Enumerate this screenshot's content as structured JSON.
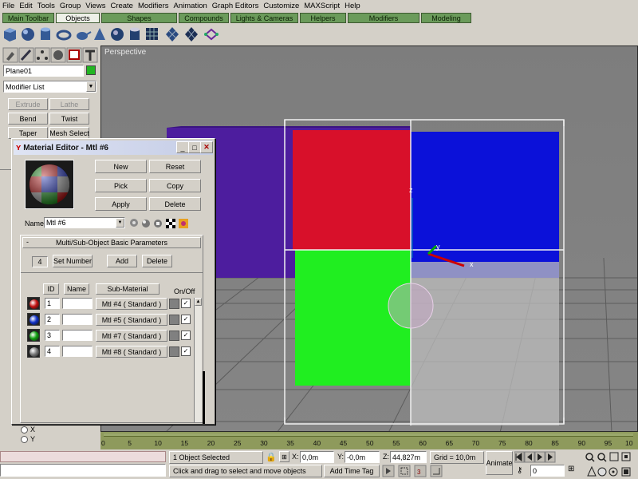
{
  "menu": [
    "File",
    "Edit",
    "Tools",
    "Group",
    "Views",
    "Create",
    "Modifiers",
    "Animation",
    "Graph Editors",
    "Customize",
    "MAXScript",
    "Help"
  ],
  "tabs": [
    "Main Toolbar",
    "Objects",
    "Shapes",
    "Compounds",
    "Lights & Cameras",
    "Helpers",
    "Modifiers",
    "Modeling"
  ],
  "toolbar_icons": [
    "box-icon",
    "sphere-icon",
    "cylinder-icon",
    "torus-icon",
    "teapot-icon",
    "cone-icon",
    "geosphere-icon",
    "tube-icon",
    "grid-icon",
    "plane-icon",
    "pyramid-icon",
    "link-icon"
  ],
  "command_panel": {
    "tab_icons": [
      "create-icon",
      "modify-icon",
      "hierarchy-icon",
      "motion-icon",
      "display-icon",
      "utilities-icon"
    ],
    "object_name": "Plane01",
    "object_color": "#22b522",
    "modifier_list": "Modifier List",
    "modifier_buttons": [
      {
        "label": "Extrude",
        "enabled": false
      },
      {
        "label": "Lathe",
        "enabled": false
      },
      {
        "label": "Bend",
        "enabled": true
      },
      {
        "label": "Twist",
        "enabled": true
      },
      {
        "label": "Taper",
        "enabled": true
      },
      {
        "label": "Mesh Select",
        "enabled": true
      }
    ],
    "axis_x": "X",
    "axis_y": "Y"
  },
  "viewport": {
    "label": "Perspective",
    "axis_z": "z",
    "axis_y": "y",
    "axis_x": "x"
  },
  "timeline": {
    "ticks": [
      "0",
      "5",
      "10",
      "15",
      "20",
      "25",
      "30",
      "35",
      "40",
      "45",
      "50",
      "55",
      "60",
      "65",
      "70",
      "75",
      "80",
      "85",
      "90",
      "95",
      "10"
    ]
  },
  "material_editor": {
    "title": "Material Editor - Mtl #6",
    "buttons": {
      "new": "New",
      "reset": "Reset",
      "pick": "Pick",
      "copy": "Copy",
      "apply": "Apply",
      "delete": "Delete"
    },
    "name_label": "Name",
    "name_value": "Mtl #6",
    "rollout_title": "Multi/Sub-Object Basic Parameters",
    "rollout_toggle": "-",
    "count": "4",
    "set_number": "Set Number",
    "add": "Add",
    "delete2": "Delete",
    "headers": {
      "id": "ID",
      "name": "Name",
      "sub_material": "Sub-Material",
      "on_off": "On/Off"
    },
    "rows": [
      {
        "id": "1",
        "name": "",
        "material": "Mtl #4  ( Standard )",
        "color": "#c41010",
        "on": "✓"
      },
      {
        "id": "2",
        "name": "",
        "material": "Mtl #5  ( Standard )",
        "color": "#1030c8",
        "on": "✓"
      },
      {
        "id": "3",
        "name": "",
        "material": "Mtl #7  ( Standard )",
        "color": "#10a010",
        "on": "✓"
      },
      {
        "id": "4",
        "name": "",
        "material": "Mtl #8  ( Standard )",
        "color": "#7a7a7a",
        "on": "✓"
      }
    ]
  },
  "status": {
    "selection": "1 Object Selected",
    "x_label": "X:",
    "x_value": "0,0m",
    "y_label": "Y:",
    "y_value": "-0,0m",
    "z_label": "Z:",
    "z_value": "44,827m",
    "grid": "Grid = 10,0m",
    "animate": "Animate",
    "frame": "0",
    "prompt": "Click and drag to select and move objects",
    "add_time_tag": "Add Time Tag"
  }
}
